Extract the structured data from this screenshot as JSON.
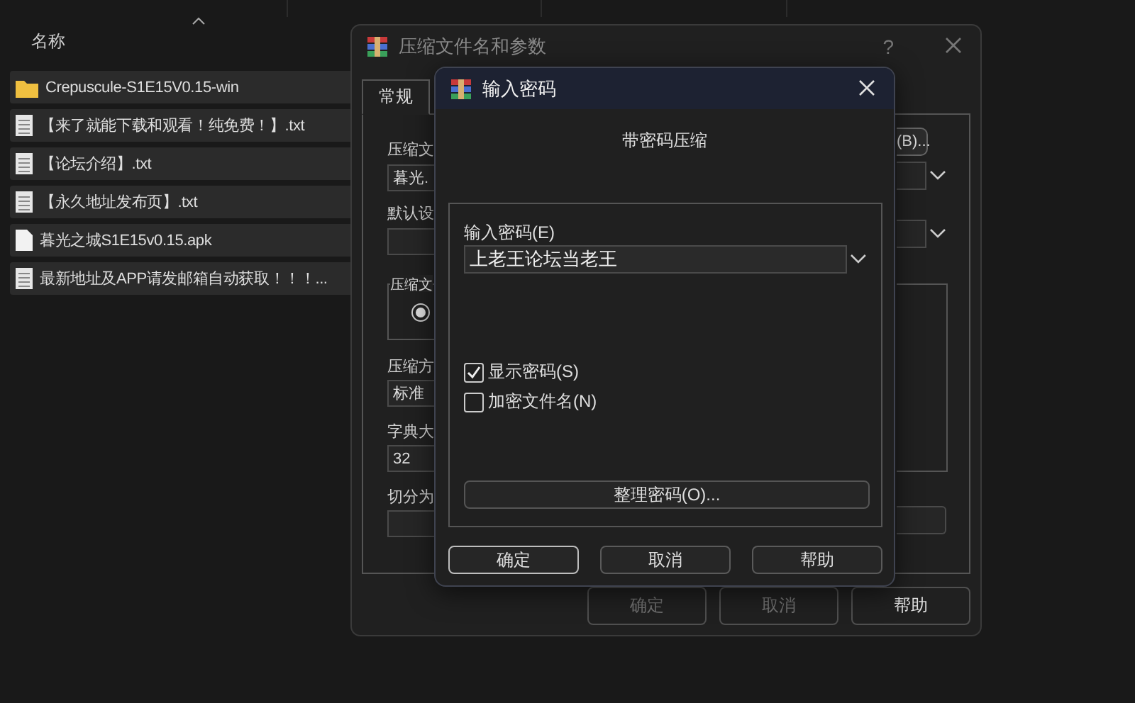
{
  "file_list": {
    "header": "名称",
    "rows": [
      {
        "name": "Crepuscule-S1E15V0.15-win",
        "kind": "folder"
      },
      {
        "name": "【来了就能下载和观看！纯免费！】.txt",
        "kind": "text"
      },
      {
        "name": "【论坛介绍】.txt",
        "kind": "text"
      },
      {
        "name": "【永久地址发布页】.txt",
        "kind": "text"
      },
      {
        "name": "暮光之城S1E15v0.15.apk",
        "kind": "file"
      },
      {
        "name": "最新地址及APP请发邮箱自动获取！！！...",
        "kind": "text"
      }
    ]
  },
  "archive_dialog": {
    "title": "压缩文件名和参数",
    "help": "?",
    "tabs": [
      {
        "label": "常规",
        "selected": true
      }
    ],
    "browse_button": "(B)...",
    "fields": [
      {
        "label": "压缩文",
        "value": "暮光."
      },
      {
        "label": "默认设"
      }
    ],
    "group": {
      "label": "压缩文",
      "radio_selected": true
    },
    "fields_lower": [
      {
        "label": "压缩方",
        "value": "标准"
      },
      {
        "label": "字典大",
        "value": "32"
      },
      {
        "label": "切分为"
      }
    ],
    "buttons": [
      {
        "label": "确定",
        "disabled": true
      },
      {
        "label": "取消",
        "disabled": true
      },
      {
        "label": "帮助",
        "disabled": false
      }
    ]
  },
  "password_dialog": {
    "title": "输入密码",
    "heading": "带密码压缩",
    "password_label": "输入密码(E)",
    "password": "上老王论坛当老王",
    "options": [
      {
        "label": "显示密码(S)",
        "checked": true
      },
      {
        "label": "加密文件名(N)",
        "checked": false
      }
    ],
    "organize_button": "整理密码(O)...",
    "buttons": [
      {
        "label": "确定",
        "default": true
      },
      {
        "label": "取消",
        "default": false
      },
      {
        "label": "帮助",
        "default": false
      }
    ]
  }
}
